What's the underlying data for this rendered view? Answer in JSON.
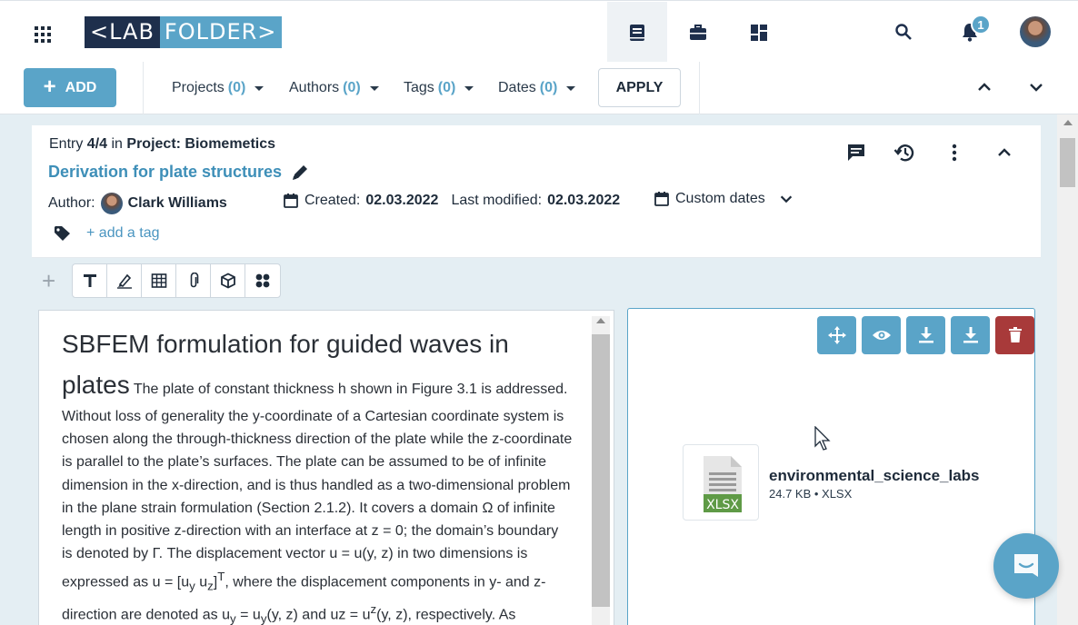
{
  "header": {
    "logo_left": "<LAB",
    "logo_right": "FOLDER>",
    "notification_count": "1"
  },
  "filters": {
    "add_label": "ADD",
    "projects_label": "Projects",
    "projects_count": "(0)",
    "authors_label": "Authors",
    "authors_count": "(0)",
    "tags_label": "Tags",
    "tags_count": "(0)",
    "dates_label": "Dates",
    "dates_count": "(0)",
    "apply_label": "APPLY"
  },
  "entry": {
    "entry_prefix": "Entry",
    "entry_position": "4/4",
    "entry_in": "in",
    "project_label": "Project: Biomemetics",
    "title": "Derivation for plate structures",
    "author_label": "Author:",
    "author_name": "Clark Williams",
    "created_label": "Created:",
    "created_date": "02.03.2022",
    "modified_label": "Last modified:",
    "modified_date": "02.03.2022",
    "custom_dates_label": "Custom dates",
    "add_tag_label": "+ add a tag"
  },
  "text_element": {
    "heading": "SBFEM formulation for guided waves in plates",
    "body": "The plate of constant thickness h shown in Figure 3.1 is addressed. Without loss of generality the y-coordinate of a Cartesian coordinate system is chosen along the through-thickness direction of the plate while the z-coordinate is parallel to the plate’s surfaces. The plate can be assumed to be of infinite dimension in the x-direction, and is thus handled as a two-dimensional problem in the plane strain formulation (Section 2.1.2). It covers a domain Ω of infinite length in positive z-direction with an interface at z = 0; the domain’s boundary is denoted by Γ. The displacement vector u = u(y, z) in two dimensions is expressed as u = [u",
    "sub_y": "y",
    "space": " u",
    "sub_z": "z",
    "bracket_end": "]",
    "sup_t": "T",
    "body2": ", where the displacement components in y- and z-direction are denoted as u",
    "sub_y2": "y",
    "eq": " = u",
    "sub_y3": "y",
    "body3": "(y, z) and uz = u",
    "sup_z": "z",
    "body4": "(y, z), respectively. As described in"
  },
  "file_element": {
    "file_name": "environmental_science_labs",
    "file_info": "24.7 KB • XLSX",
    "file_ext": "XLSX"
  },
  "colors": {
    "brand_dark": "#1e2f4c",
    "brand_accent": "#5aa4c8",
    "delete_red": "#a83a3a"
  }
}
